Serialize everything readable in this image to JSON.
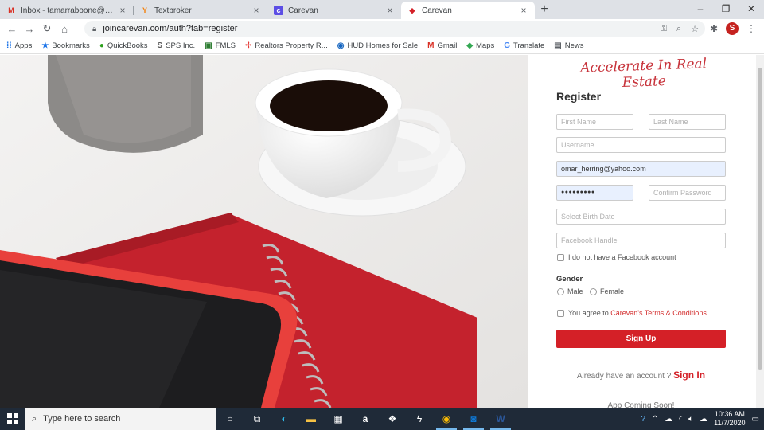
{
  "browser": {
    "tabs": [
      {
        "title": "Inbox - tamarraboone@gmail.com",
        "icon": "gmail-icon",
        "active": false
      },
      {
        "title": "Textbroker",
        "icon": "textbroker-icon",
        "active": false
      },
      {
        "title": "Carevan",
        "icon": "carevan-icon",
        "active": false
      },
      {
        "title": "Carevan",
        "icon": "carevan-icon",
        "active": true
      }
    ],
    "url": "joincarevan.com/auth?tab=register",
    "profile_initial": "S",
    "bookmarks": [
      {
        "label": "Apps",
        "icon": "apps-icon",
        "glyph": "⋮⋮",
        "color": "#1a73e8"
      },
      {
        "label": "Bookmarks",
        "icon": "star-icon",
        "glyph": "★",
        "color": "#1a73e8"
      },
      {
        "label": "QuickBooks",
        "icon": "quickbooks-icon",
        "glyph": "ⓠ",
        "color": "#2ca01c"
      },
      {
        "label": "SPS Inc.",
        "icon": "sps-icon",
        "glyph": "$",
        "color": "#555"
      },
      {
        "label": "FMLS",
        "icon": "fmls-icon",
        "glyph": "▣",
        "color": "#2e7d32"
      },
      {
        "label": "Realtors Property R...",
        "icon": "realtors-icon",
        "glyph": "✢",
        "color": "#e53935"
      },
      {
        "label": "HUD Homes for Sale",
        "icon": "hud-icon",
        "glyph": "◉",
        "color": "#1565c0"
      },
      {
        "label": "Gmail",
        "icon": "gmail-icon",
        "glyph": "M",
        "color": "#d93025"
      },
      {
        "label": "Maps",
        "icon": "maps-icon",
        "glyph": "◆",
        "color": "#34a853"
      },
      {
        "label": "Translate",
        "icon": "translate-icon",
        "glyph": "文",
        "color": "#4285f4"
      },
      {
        "label": "News",
        "icon": "news-icon",
        "glyph": "▤",
        "color": "#5f6368"
      }
    ]
  },
  "page": {
    "tagline": "Accelerate In Real Estate",
    "heading": "Register",
    "first_name_placeholder": "First Name",
    "last_name_placeholder": "Last Name",
    "username_placeholder": "Username",
    "email_value": "omar_herring@yahoo.com",
    "password_value": "●●●●●●●●●",
    "confirm_password_placeholder": "Confirm Password",
    "birth_date_placeholder": "Select Birth Date",
    "facebook_placeholder": "Facebook Handle",
    "no_facebook_label": "I do not have a Facebook account",
    "gender_label": "Gender",
    "gender_options": [
      "Male",
      "Female"
    ],
    "terms_prefix": "You agree to ",
    "terms_link": "Carevan's Terms & Conditions",
    "signup_button": "Sign Up",
    "already_text": "Already have an account ?",
    "signin_link": "Sign In",
    "app_coming_soon": "App Coming Soon!"
  },
  "taskbar": {
    "search_placeholder": "Type here to search",
    "time": "10:36 AM",
    "date": "11/7/2020"
  },
  "colors": {
    "brand_red": "#d42027",
    "autofill_blue": "#e8f0fe"
  }
}
